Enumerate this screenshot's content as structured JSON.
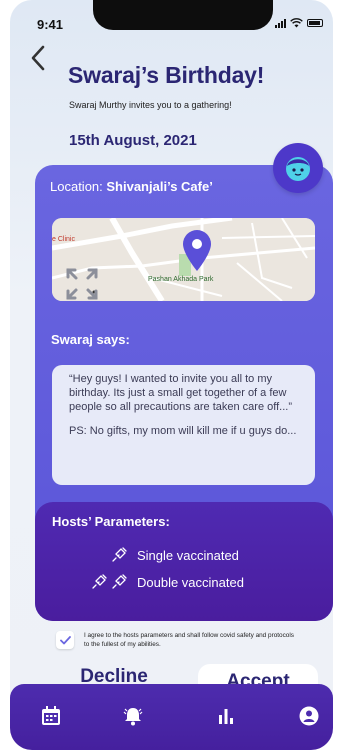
{
  "status_bar": {
    "time": "9:41"
  },
  "event": {
    "title": "Swaraj’s Birthday!",
    "subtitle": "Swaraj Murthy invites you to a gathering!",
    "date": "15th August, 2021"
  },
  "location": {
    "label": "Location: ",
    "name": "Shivanjali’s Cafe’",
    "map_labels": [
      "e Clinic",
      "Pashan Akhada Park"
    ]
  },
  "host_message": {
    "heading": "Swaraj says:",
    "paragraph1": "“Hey guys! I wanted to invite you all to my birthday. Its just a small get together of a few people so all precautions are taken care off...”",
    "paragraph2": "PS: No gifts, my mom will kill me if u guys do..."
  },
  "hosts_parameters": {
    "title": "Hosts’ Parameters:",
    "items": [
      {
        "label": "Single vaccinated",
        "doses": 1
      },
      {
        "label": "Double vaccinated",
        "doses": 2
      }
    ]
  },
  "agreement": {
    "checked": true,
    "text": "I agree to the hosts parameters and shall follow covid safety and protocols to the fullest of my abilities."
  },
  "actions": {
    "decline": "Decline",
    "accept": "Accept"
  },
  "tabbar": {
    "items": [
      {
        "icon": "calendar-icon"
      },
      {
        "icon": "bell-icon"
      },
      {
        "icon": "bar-chart-icon"
      },
      {
        "icon": "profile-icon"
      }
    ]
  },
  "colors": {
    "primary_text": "#2b2673",
    "card": "#6a66e0",
    "hosts_panel": "#4f2ab2",
    "tabbar": "#4d2cae",
    "avatar": "#4d38c9",
    "avatar_face": "#4fd1e8"
  }
}
